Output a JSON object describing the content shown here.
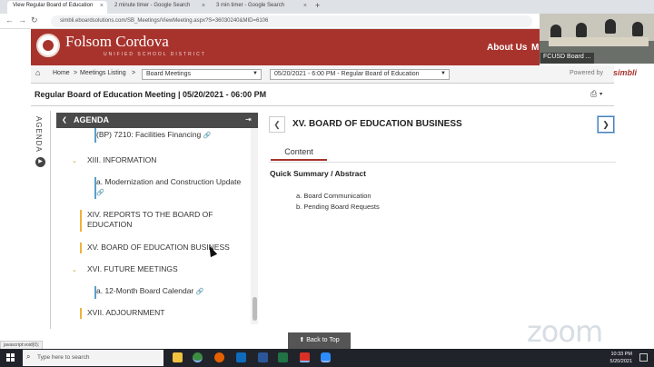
{
  "browser": {
    "tabs": [
      {
        "label": "View Regular Board of Education",
        "active": true
      },
      {
        "label": "2 minute timer - Google Search",
        "active": false
      },
      {
        "label": "3 min timer - Google Search",
        "active": false
      }
    ],
    "new_tab": "+",
    "url": "simbli.eboardsolutions.com/SB_Meetings/ViewMeeting.aspx?S=36030240&MID=6106"
  },
  "site": {
    "name": "Folsom Cordova",
    "subtitle": "UNIFIED SCHOOL DISTRICT",
    "nav_about": "About Us",
    "nav_more": "M"
  },
  "video": {
    "label": "FCUSD Board ..."
  },
  "breadcrumb": {
    "home": "Home",
    "sep1": ">",
    "meetings": "Meetings Listing",
    "sep2": ">",
    "meeting_type": "Board Meetings",
    "meeting_select": "05/20/2021 - 6:00 PM - Regular Board of Education",
    "powered_by": "Powered by",
    "brand": "simbli"
  },
  "meeting": {
    "title": "Regular Board of Education Meeting | 05/20/2021 - 06:00 PM"
  },
  "agenda": {
    "side_tab": "AGENDA",
    "header": "AGENDA",
    "items": [
      {
        "text": "(BP) 7210: Facilities Financing",
        "sub": true,
        "link": true
      },
      {
        "text": "XIII. INFORMATION",
        "sub": false,
        "toggle": true
      },
      {
        "text": "a. Modernization and Construction Update",
        "sub": true,
        "link": true
      },
      {
        "text": "XIV. REPORTS TO THE BOARD OF EDUCATION",
        "sub": false
      },
      {
        "text": "XV. BOARD OF EDUCATION BUSINESS",
        "sub": false,
        "selected": true
      },
      {
        "text": "XVI. FUTURE MEETINGS",
        "sub": false,
        "toggle": true
      },
      {
        "text": "a. 12-Month Board Calendar",
        "sub": true,
        "link": true
      },
      {
        "text": "XVII. ADJOURNMENT",
        "sub": false
      }
    ]
  },
  "content": {
    "item_title": "XV. BOARD OF EDUCATION BUSINESS",
    "tab": "Content",
    "section": "Quick Summary / Abstract",
    "summary_items": [
      "a. Board Communication",
      "b. Pending Board Requests"
    ]
  },
  "back_to_top": "Back to Top",
  "watermark": "zoom",
  "status_url": "javascript:void(0);",
  "taskbar": {
    "search_placeholder": "Type here to search",
    "time": "10:33 PM",
    "date": "5/20/2021"
  },
  "colors": {
    "brand": "#a8332d",
    "agenda_bar": "#f0b23a",
    "sub_bar": "#5aa0c9"
  }
}
